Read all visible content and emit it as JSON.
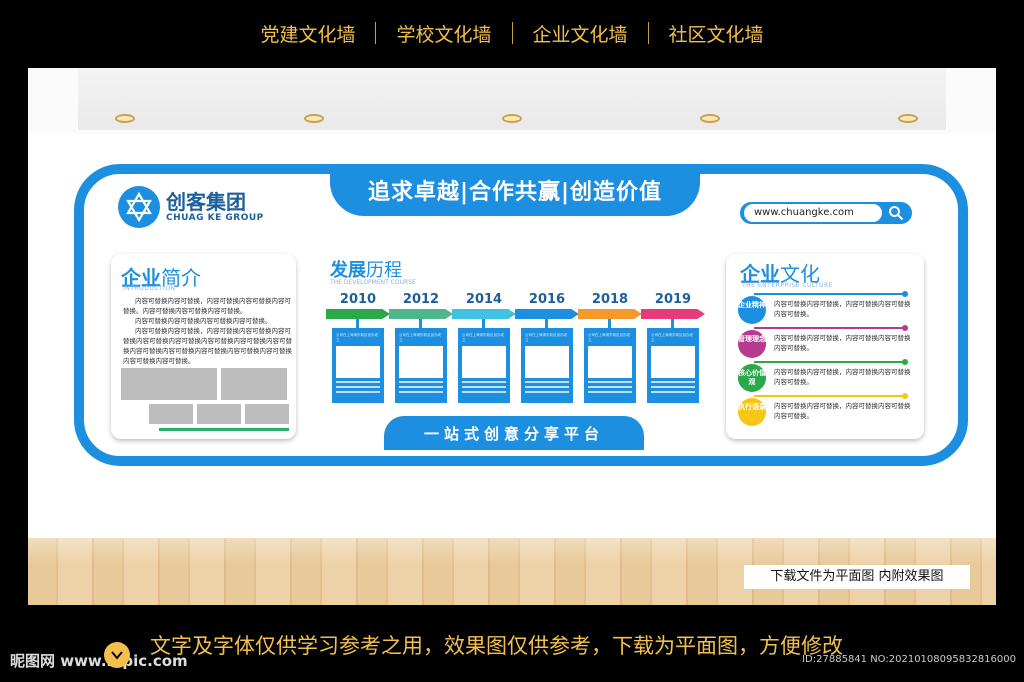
{
  "topnav": {
    "items": [
      "党建文化墙",
      "学校文化墙",
      "企业文化墙",
      "社区文化墙"
    ]
  },
  "board": {
    "slogan": "追求卓越|合作共赢|创造价值",
    "bottom_bar": "一站式创意分享平台",
    "brand_cn": "创客集团",
    "brand_en": "CHUAG KE GROUP",
    "url": "www.chuangke.com"
  },
  "intro_panel": {
    "title_bold": "企业",
    "title_light": "简介",
    "subtitle": "INTRODUCTION",
    "paragraphs": [
      "内容可替换内容可替换，内容可替换内容可替换内容可替换。内容可替换内容可替换内容可替换。",
      "内容可替换内容可替换内容可替换内容可替换。",
      "内容可替换内容可替换，内容可替换内容可替换内容可替换内容可替换内容可替换内容可替换内容可替换内容可替换内容可替换内容可替换内容可替换内容可替换内容可替换内容可替换内容可替换。"
    ]
  },
  "timeline": {
    "title_bold": "发展",
    "title_light": "历程",
    "subtitle": "THE DEVELOPMENT COURSE",
    "years": [
      "2010",
      "2012",
      "2014",
      "2016",
      "2018",
      "2019"
    ],
    "arrow_colors": [
      "#2aa84a",
      "#4fb58a",
      "#40c2e0",
      "#1d8fe0",
      "#f59a2a",
      "#e63b7a"
    ],
    "card_text": "公司在上海浦东新区创办成立"
  },
  "culture_panel": {
    "title_bold": "企业",
    "title_light": "文化",
    "subtitle": "THE ENTERPRISE CULTURE",
    "rows": [
      {
        "badge": "企业精神",
        "color": "#1d8fe0",
        "text": "内容可替换内容可替换，内容可替换内容可替换内容可替换。"
      },
      {
        "badge": "管理理念",
        "color": "#b63a8e",
        "text": "内容可替换内容可替换，内容可替换内容可替换内容可替换。"
      },
      {
        "badge": "核心价值观",
        "color": "#2aa84a",
        "text": "内容可替换内容可替换，内容可替换内容可替换内容可替换。"
      },
      {
        "badge": "执行语录",
        "color": "#f5c518",
        "text": "内容可替换内容可替换，内容可替换内容可替换内容可替换。"
      }
    ]
  },
  "room": {
    "note": "下载文件为平面图  内附效果图"
  },
  "footer": {
    "brand": "昵图网 www.nipic.com",
    "notice": "文字及字体仅供学习参考之用，效果图仅供参考，下载为平面图，方便修改",
    "id": "ID:27885841 NO:20210108095832816000"
  }
}
